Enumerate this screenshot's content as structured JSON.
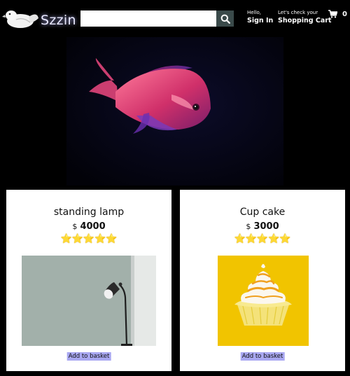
{
  "header": {
    "logo_text": "Szzin",
    "logo_icon": "duck-logo-icon",
    "search": {
      "value": "",
      "placeholder": ""
    },
    "search_icon": "search-icon",
    "account": {
      "line1": "Hello,",
      "line2": "Sign In"
    },
    "orders": {
      "line1": "Let's check your",
      "line2": "Shopping Cart"
    },
    "cart": {
      "icon": "shopping-cart-icon",
      "count": "0"
    }
  },
  "banner": {
    "image": "fish-banner-image"
  },
  "products": [
    {
      "title": "standing lamp",
      "currency": "$",
      "price": "4000",
      "rating": 5,
      "stars": "⭐⭐⭐⭐⭐",
      "image": "standing-lamp-image",
      "button": "Add to basket"
    },
    {
      "title": "Cup cake",
      "currency": "$",
      "price": "3000",
      "rating": 5,
      "stars": "⭐⭐⭐⭐⭐",
      "image": "cupcake-image",
      "button": "Add to basket"
    }
  ],
  "colors": {
    "accent_button": "#a9a8f2",
    "background": "#000000",
    "card": "#ffffff",
    "search_button": "#3a4a4a"
  }
}
